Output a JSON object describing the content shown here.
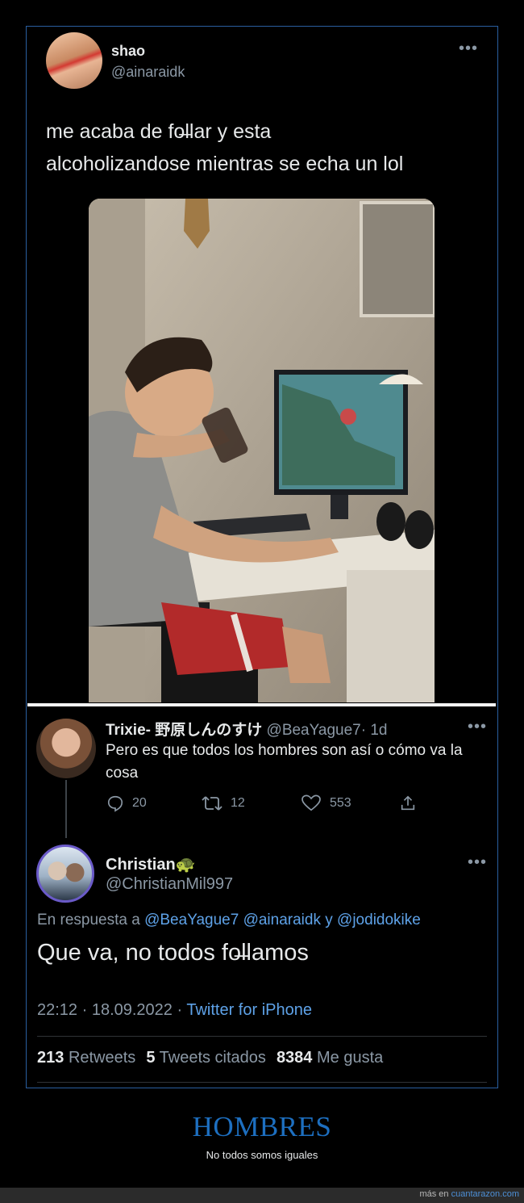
{
  "tweet": {
    "name": "shao",
    "handle": "@ainaraidk",
    "text_line1": "me acaba de fo̶llar y esta",
    "text_line2": "alcoholizandose mientras se echa un lol"
  },
  "reply": {
    "name": "Trixie- 野原しんのすけ",
    "handle": "@BeaYague7",
    "time": "· 1d",
    "text": "Pero es que todos los hombres son así o cómo va la cosa",
    "replies": "20",
    "retweets": "12",
    "likes": "553"
  },
  "main": {
    "name": "Christian",
    "name_emoji": "🐢",
    "handle": "@ChristianMil997",
    "in_reply_prefix": "En respuesta a",
    "mention1": "@BeaYague7",
    "mention2": "@ainaraidk",
    "connector": "y",
    "mention3": "@jodidokike",
    "text": "Que va, no todos fo̶llamos",
    "timestamp": "22:12 · 18.09.2022 ·",
    "source": "Twitter for iPhone",
    "retweets_count": "213",
    "retweets_label": "Retweets",
    "quotes_count": "5",
    "quotes_label": "Tweets citados",
    "likes_count": "8384",
    "likes_label": "Me gusta"
  },
  "footer": {
    "title": "HOMBRES",
    "subtitle": "No todos somos iguales",
    "credit_prefix": "más en",
    "credit_site": "cuantarazon.com"
  },
  "icons": {
    "more": "more-icon",
    "reply": "reply-icon",
    "retweet": "retweet-icon",
    "like": "heart-icon",
    "share": "share-icon"
  },
  "colors": {
    "background": "#000000",
    "link": "#5ea2e8",
    "muted": "#8b98a5",
    "frame": "#2a5fa0",
    "title": "#1d6fc0"
  }
}
